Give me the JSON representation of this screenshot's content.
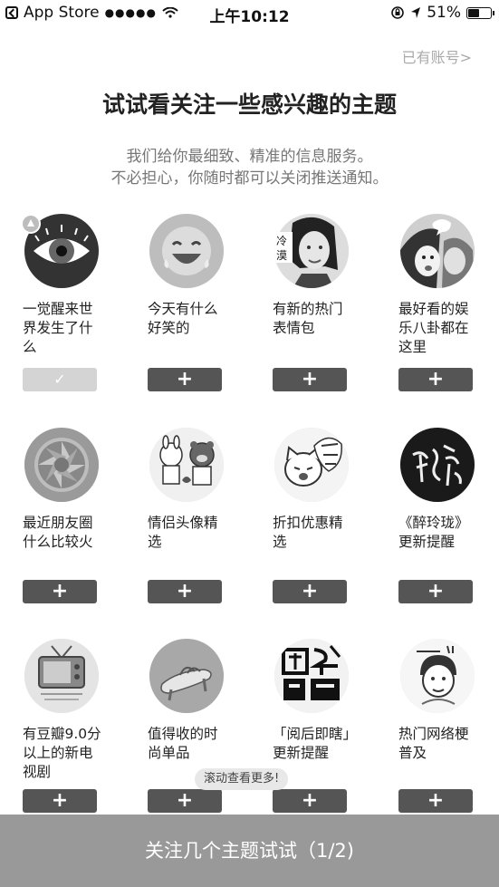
{
  "status_bar": {
    "back_app": "App Store",
    "signal": "●●●●●",
    "time": "上午10:12",
    "battery": "51%",
    "battery_level": 0.51
  },
  "header": {
    "have_account": "已有账号>",
    "title": "试试看关注一些感兴趣的主题",
    "subtitle_line1": "我们给你最细致、精准的信息服务。",
    "subtitle_line2": "不必担心，你随时都可以关闭推送通知。"
  },
  "topics": [
    {
      "label": "一觉醒来世界发生了什么",
      "button": "✓",
      "checked": true,
      "icon": "eye-icon"
    },
    {
      "label": "今天有什么好笑的",
      "button": "+",
      "checked": false,
      "icon": "laughing-emoji-icon"
    },
    {
      "label": "有新的热门表情包",
      "button": "+",
      "checked": false,
      "icon": "woman-face-meme-icon"
    },
    {
      "label": "最好看的娱乐八卦都在这里",
      "button": "+",
      "checked": false,
      "icon": "gossip-cartoon-icon"
    },
    {
      "label": "最近朋友圈什么比较火",
      "button": "+",
      "checked": false,
      "icon": "camera-shutter-icon"
    },
    {
      "label": "情侣头像精选",
      "button": "+",
      "checked": false,
      "icon": "couple-bears-icon"
    },
    {
      "label": "折扣优惠精选",
      "button": "+",
      "checked": false,
      "icon": "shopping-cat-icon"
    },
    {
      "label": "《醉玲珑》更新提醒",
      "button": "+",
      "checked": false,
      "icon": "calligraphy-icon"
    },
    {
      "label": "有豆瓣9.0分以上的新电视剧",
      "button": "+",
      "checked": false,
      "icon": "retro-tv-icon"
    },
    {
      "label": "值得收的时尚单品",
      "button": "+",
      "checked": false,
      "icon": "sandal-icon"
    },
    {
      "label": "「阅后即瞎」更新提醒",
      "button": "+",
      "checked": false,
      "icon": "chinese-text-logo-icon"
    },
    {
      "label": "热门网络梗普及",
      "button": "+",
      "checked": false,
      "icon": "duang-cartoon-icon"
    }
  ],
  "scroll_hint": "滚动查看更多!",
  "bottom_button": "关注几个主题试试（1/2)",
  "colors": {
    "button_bg": "#555555",
    "checked_bg": "#d4d4d4",
    "bottom_bar": "#999999"
  }
}
